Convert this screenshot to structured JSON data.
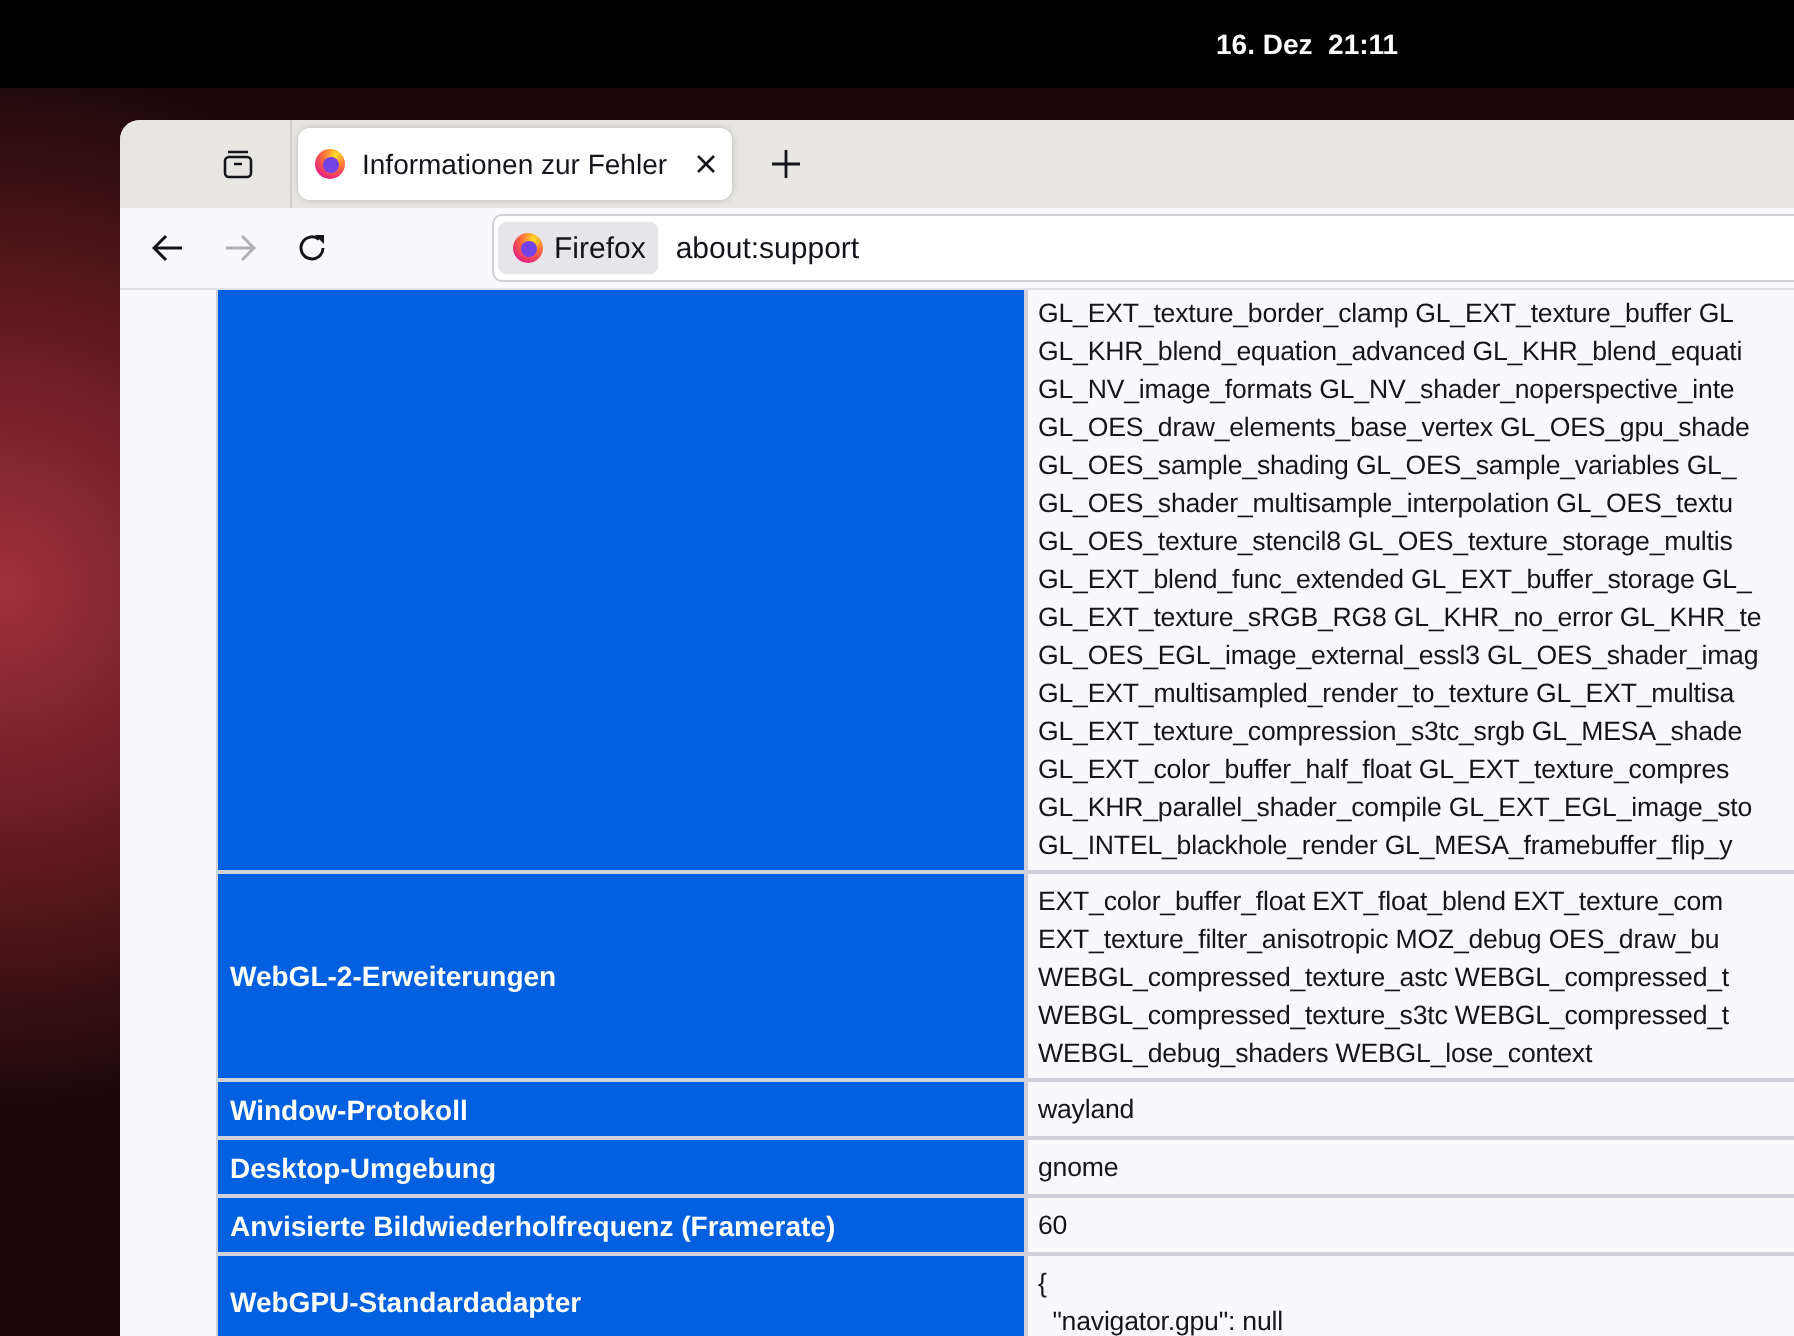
{
  "top_bar": {
    "date": "16. Dez",
    "time": "21:11"
  },
  "tabs": [
    {
      "title": "Informationen zur Fehler",
      "selected": true
    }
  ],
  "toolbar": {
    "forward_disabled": true,
    "identity": "Firefox",
    "url": "about:support"
  },
  "table": {
    "rows": [
      {
        "value": "GL_EXT_texture_border_clamp GL_EXT_texture_buffer GL\nGL_KHR_blend_equation_advanced GL_KHR_blend_equati\nGL_NV_image_formats GL_NV_shader_noperspective_inte\nGL_OES_draw_elements_base_vertex GL_OES_gpu_shade\nGL_OES_sample_shading GL_OES_sample_variables GL_\nGL_OES_shader_multisample_interpolation GL_OES_textu\nGL_OES_texture_stencil8 GL_OES_texture_storage_multis\nGL_EXT_blend_func_extended GL_EXT_buffer_storage GL_\nGL_EXT_texture_sRGB_RG8 GL_KHR_no_error GL_KHR_te\nGL_OES_EGL_image_external_essl3 GL_OES_shader_imag\nGL_EXT_multisampled_render_to_texture GL_EXT_multisa\nGL_EXT_texture_compression_s3tc_srgb GL_MESA_shade\nGL_EXT_color_buffer_half_float GL_EXT_texture_compres\nGL_KHR_parallel_shader_compile GL_EXT_EGL_image_sto\nGL_INTEL_blackhole_render GL_MESA_framebuffer_flip_y"
      },
      {
        "label": "WebGL-2-Erweiterungen",
        "value": "EXT_color_buffer_float EXT_float_blend EXT_texture_com\nEXT_texture_filter_anisotropic MOZ_debug OES_draw_bu\nWEBGL_compressed_texture_astc WEBGL_compressed_t\nWEBGL_compressed_texture_s3tc WEBGL_compressed_t\nWEBGL_debug_shaders WEBGL_lose_context"
      },
      {
        "label": "Window-Protokoll",
        "value": "wayland"
      },
      {
        "label": "Desktop-Umgebung",
        "value": "gnome"
      },
      {
        "label": "Anvisierte Bildwiederholfrequenz (Framerate)",
        "value": "60"
      },
      {
        "label": "WebGPU-Standardadapter",
        "value": "{\n  \"navigator.gpu\": null"
      }
    ]
  }
}
